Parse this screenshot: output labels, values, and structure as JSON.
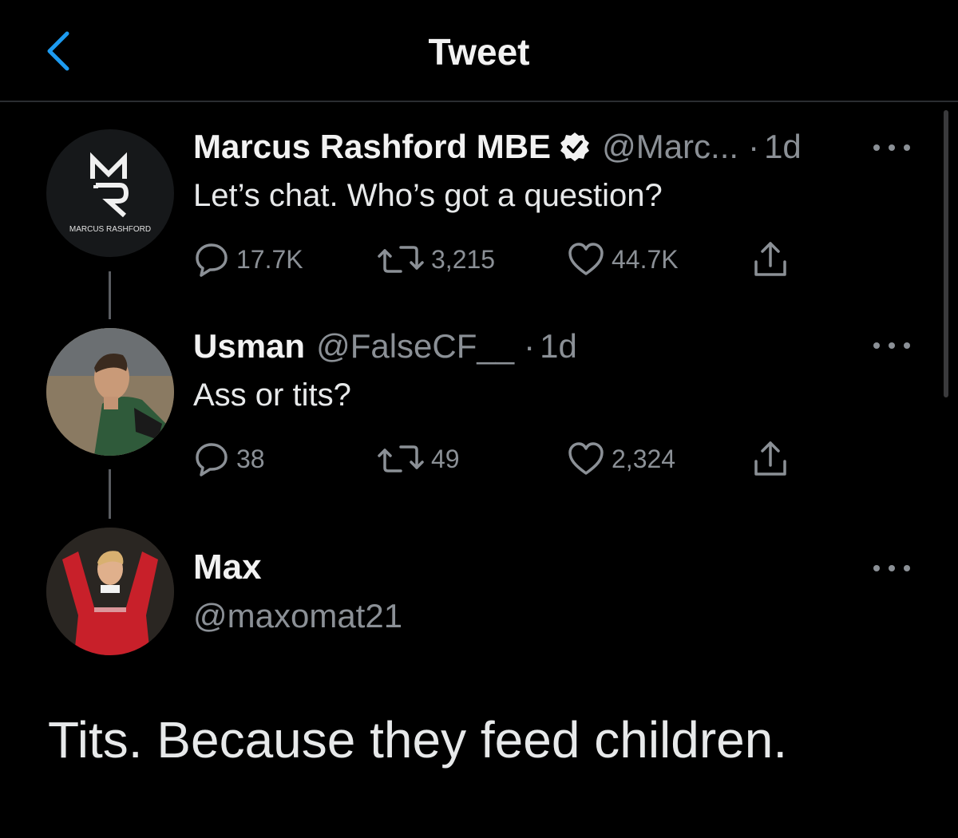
{
  "header": {
    "title": "Tweet"
  },
  "tweets": [
    {
      "name": "Marcus Rashford MBE",
      "verified": true,
      "handle": "@Marc...",
      "time": "1d",
      "text": "Let’s chat. Who’s got a question?",
      "replies": "17.7K",
      "retweets": "3,215",
      "likes": "44.7K",
      "avatar_text": "MARCUS RASHFORD"
    },
    {
      "name": "Usman",
      "handle": "@FalseCF__",
      "time": "1d",
      "text": "Ass or tits?",
      "replies": "38",
      "retweets": "49",
      "likes": "2,324"
    }
  ],
  "reply": {
    "name": "Max",
    "handle": "@maxomat21",
    "text": "Tits. Because they feed children."
  },
  "colors": {
    "background": "#000000",
    "accent": "#1d9bf0",
    "muted": "#8b9096",
    "text": "#e7e9ea"
  },
  "icons": [
    "chevron-left-icon",
    "verified-badge-icon",
    "more-icon",
    "reply-icon",
    "retweet-icon",
    "like-icon",
    "share-icon"
  ]
}
